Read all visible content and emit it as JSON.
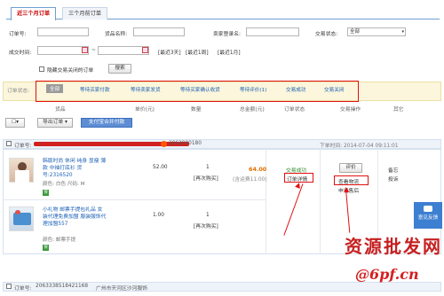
{
  "tabs": [
    {
      "label": "近三个月订单",
      "active": true
    },
    {
      "label": "三个月前订单",
      "active": false
    }
  ],
  "search": {
    "order_no_label": "订单号:",
    "product_name_label": "货品名称:",
    "buyer_label": "卖家登录名:",
    "status_label": "交易状态:",
    "status_value": "全部",
    "date_label": "成交时间:",
    "date_sep": "~",
    "quick_links": [
      "[最近3天]",
      "[最近1周]",
      "[最近1月]"
    ],
    "hide_closed_label": "隐藏交易关闭的订单",
    "search_button": "搜索"
  },
  "filter": {
    "label": "订单状态:",
    "chips": [
      "全部",
      "等待买家付款",
      "等待卖家发货",
      "等待买家确认收货",
      "等待评价(1)",
      "交易成功",
      "交易关闭"
    ]
  },
  "columns": {
    "product": "货品",
    "price": "单价(元)",
    "qty": "数量",
    "total": "总金额(元)",
    "status": "订单状态",
    "action": "交易操作",
    "other": "其它"
  },
  "toolbar": {
    "export_label": "导出订单 ▾",
    "pay_label": "支付宝合并付款"
  },
  "order1": {
    "order_no_label": "订单号:",
    "order_no": "2062000180",
    "time": "下单时间: 2014-07-04 09:11:01",
    "items": [
      {
        "title": "韩版时尚 休闲 纯身 显瘦 薄款 中袖打底衫 货号:2316520",
        "color": "颜色: 白色  尺码: M",
        "price": "52.00",
        "qty": "1",
        "rebuy": "[再次购买]"
      },
      {
        "title": "小礼物 邮票手提包礼品 女装代理免费加盟 服装服饰代理加盟557",
        "color": "颜色: 邮票手提",
        "price": "1.00",
        "qty": "1",
        "rebuy": "[再次购买]"
      }
    ],
    "total": "64.00",
    "shipping": "(含运费11.00)",
    "status": "交易成功",
    "status_detail_link": "订单详情",
    "rate_button": "评价",
    "logistics_link": "查看物流",
    "refund_link": "申请售后",
    "other": [
      "备忘",
      "投诉"
    ]
  },
  "order2": {
    "order_no_label": "订单号:",
    "order_no": "2063338518421168",
    "shop": "广州市天河区沙河服饰"
  },
  "feedback_button": "意见反馈",
  "watermark": {
    "line1": "资源批发网",
    "line2": "@6pf.cn"
  },
  "colors": {
    "accent_red": "#e01010",
    "link_blue": "#1a5fb4",
    "price_orange": "#e07000",
    "success_green": "#2a8a2a",
    "filter_bg": "#fbf6dc"
  }
}
